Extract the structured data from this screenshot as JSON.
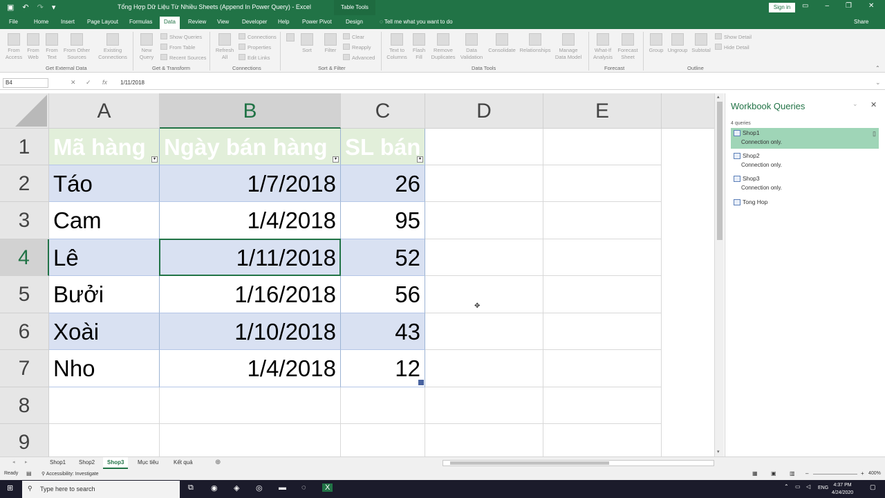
{
  "app": {
    "title": "Tổng Hợp Dữ Liệu Từ Nhiều Sheets (Append In Power Query) - Excel",
    "table_tools": "Table Tools",
    "sign_in": "Sign in",
    "share": "Share"
  },
  "tabs": [
    "File",
    "Home",
    "Insert",
    "Page Layout",
    "Formulas",
    "Data",
    "Review",
    "View",
    "Developer",
    "Help",
    "Power Pivot",
    "Design"
  ],
  "tell_me": "Tell me what you want to do",
  "ribbon": {
    "get_external": {
      "from_access": "From Access",
      "from_web": "From Web",
      "from_text": "From Text",
      "from_other": "From Other Sources",
      "existing": "Existing Connections",
      "label": "Get External Data"
    },
    "get_transform": {
      "new_query": "New Query",
      "show_queries": "Show Queries",
      "from_table": "From Table",
      "recent_sources": "Recent Sources",
      "label": "Get & Transform"
    },
    "connections": {
      "refresh_all": "Refresh All",
      "connections": "Connections",
      "properties": "Properties",
      "edit_links": "Edit Links",
      "label": "Connections"
    },
    "sort_filter": {
      "sort": "Sort",
      "filter": "Filter",
      "clear": "Clear",
      "reapply": "Reapply",
      "advanced": "Advanced",
      "label": "Sort & Filter"
    },
    "data_tools": {
      "text_to_columns": "Text to Columns",
      "flash_fill": "Flash Fill",
      "remove_duplicates": "Remove Duplicates",
      "data_validation": "Data Validation",
      "consolidate": "Consolidate",
      "relationships": "Relationships",
      "manage_model": "Manage Data Model",
      "label": "Data Tools"
    },
    "forecast": {
      "what_if": "What-If Analysis",
      "forecast_sheet": "Forecast Sheet",
      "label": "Forecast"
    },
    "outline": {
      "group": "Group",
      "ungroup": "Ungroup",
      "subtotal": "Subtotal",
      "show_detail": "Show Detail",
      "hide_detail": "Hide Detail",
      "label": "Outline"
    }
  },
  "formula_bar": {
    "name_box": "B4",
    "fx": "fx",
    "formula": "1/11/2018"
  },
  "sheet": {
    "columns": [
      "A",
      "B",
      "C",
      "D",
      "E"
    ],
    "rows": [
      "1",
      "2",
      "3",
      "4",
      "5",
      "6",
      "7",
      "8",
      "9"
    ],
    "header": [
      "Mã hàng",
      "Ngày bán hàng",
      "SL bán"
    ],
    "data": [
      [
        "Táo",
        "1/7/2018",
        "26"
      ],
      [
        "Cam",
        "1/4/2018",
        "95"
      ],
      [
        "Lê",
        "1/11/2018",
        "52"
      ],
      [
        "Bưởi",
        "1/16/2018",
        "56"
      ],
      [
        "Xoài",
        "1/10/2018",
        "43"
      ],
      [
        "Nho",
        "1/4/2018",
        "12"
      ]
    ],
    "selected_cell": "B4"
  },
  "queries_panel": {
    "title": "Workbook Queries",
    "count": "4 queries",
    "items": [
      {
        "name": "Shop1",
        "status": "Connection only."
      },
      {
        "name": "Shop2",
        "status": "Connection only."
      },
      {
        "name": "Shop3",
        "status": "Connection only."
      },
      {
        "name": "Tong Hop",
        "status": ""
      }
    ]
  },
  "sheet_tabs": [
    "Shop1",
    "Shop2",
    "Shop3",
    "Mục tiêu",
    "Kết quả"
  ],
  "active_sheet": "Shop3",
  "status": {
    "ready": "Ready",
    "accessibility": "Accessibility: Investigate",
    "zoom": "400%"
  },
  "taskbar": {
    "search_placeholder": "Type here to search",
    "lang": "ENG",
    "time": "4:37 PM",
    "date": "4/24/2020"
  },
  "colors": {
    "excel_green": "#217346",
    "table_header": "#e2efda",
    "band": "#d9e1f2",
    "query_selected": "#9fd5b7"
  }
}
